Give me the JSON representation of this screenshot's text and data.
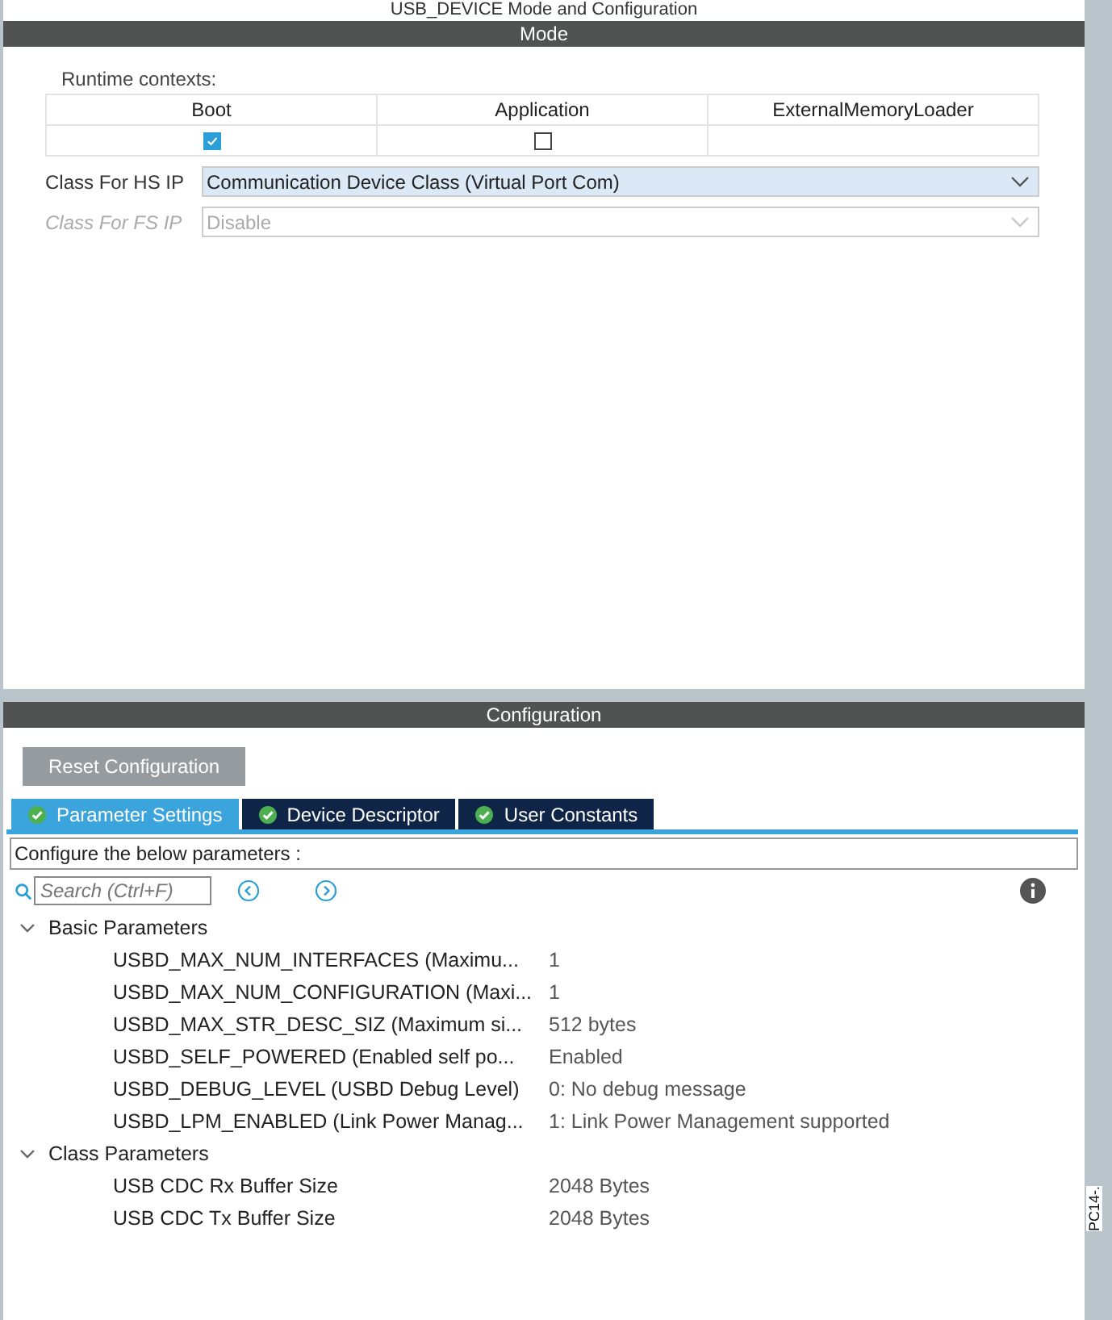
{
  "window": {
    "title": "USB_DEVICE Mode and Configuration"
  },
  "mode": {
    "title": "Mode",
    "runtime_label": "Runtime contexts:",
    "contexts": [
      {
        "label": "Boot",
        "checked": true
      },
      {
        "label": "Application",
        "checked": false
      },
      {
        "label": "ExternalMemoryLoader"
      }
    ],
    "fields": [
      {
        "label": "Class For HS IP",
        "value": "Communication Device Class (Virtual Port Com)",
        "disabled": false
      },
      {
        "label": "Class For FS IP",
        "value": "Disable",
        "disabled": true
      }
    ]
  },
  "configuration": {
    "title": "Configuration",
    "reset_button": "Reset Configuration",
    "tabs": [
      {
        "label": "Parameter Settings",
        "selected": true
      },
      {
        "label": "Device Descriptor",
        "selected": false
      },
      {
        "label": "User Constants",
        "selected": false
      }
    ],
    "hint": "Configure the below parameters :",
    "search": {
      "placeholder": "Search (Ctrl+F)"
    },
    "groups": [
      {
        "label": "Basic Parameters",
        "expanded": true,
        "children": [
          {
            "name": "USBD_MAX_NUM_INTERFACES (Maximu...",
            "value": "1"
          },
          {
            "name": "USBD_MAX_NUM_CONFIGURATION (Maxi...",
            "value": "1"
          },
          {
            "name": "USBD_MAX_STR_DESC_SIZ (Maximum si...",
            "value": "512 bytes"
          },
          {
            "name": "USBD_SELF_POWERED (Enabled self po...",
            "value": "Enabled"
          },
          {
            "name": "USBD_DEBUG_LEVEL (USBD Debug Level)",
            "value": "0: No debug message"
          },
          {
            "name": "USBD_LPM_ENABLED (Link Power Manag...",
            "value": "1: Link Power Management supported"
          }
        ]
      },
      {
        "label": "Class Parameters",
        "expanded": true,
        "children": [
          {
            "name": "USB CDC Rx Buffer Size",
            "value": "2048 Bytes"
          },
          {
            "name": "USB CDC Tx Buffer Size",
            "value": "2048 Bytes"
          }
        ]
      }
    ]
  },
  "side_strip": {
    "label": "PC14-."
  }
}
